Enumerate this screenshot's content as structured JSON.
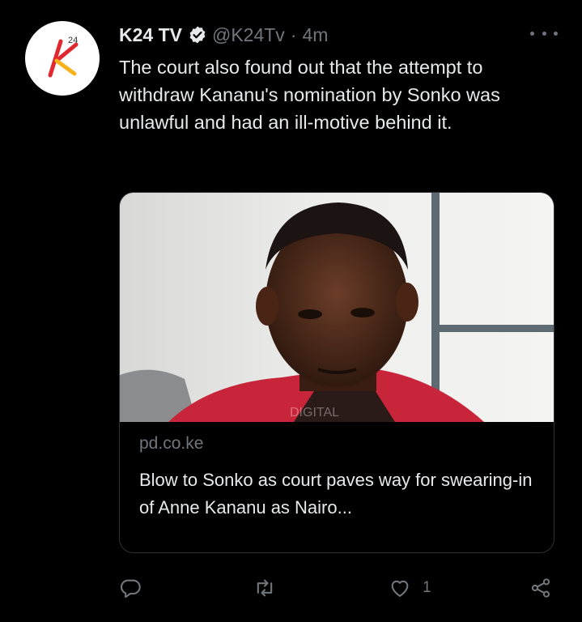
{
  "tweet": {
    "author_name": "K24 TV",
    "handle": "@K24Tv",
    "separator": "·",
    "time": "4m",
    "text": "The court also found out that the attempt to withdraw Kananu's nomination by Sonko was unlawful and had an ill-motive behind it.",
    "avatar_logo_text": "K24",
    "colors": {
      "verified": "#e7e9ea",
      "muted": "#71767b",
      "logo_red": "#e0282e",
      "logo_yellow": "#f6b21a"
    }
  },
  "card": {
    "domain": "pd.co.ke",
    "title": "Blow to Sonko as court paves way for swearing-in of Anne Kananu as Nairo...",
    "image_watermark": "DIGITAL"
  },
  "actions": {
    "reply_icon": "reply-icon",
    "retweet_icon": "retweet-icon",
    "like_icon": "heart-icon",
    "like_count": "1",
    "share_icon": "share-icon"
  }
}
